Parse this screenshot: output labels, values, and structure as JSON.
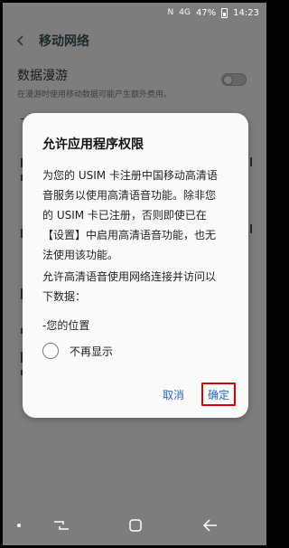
{
  "status_bar": {
    "nfc": "N",
    "signal": "4G",
    "battery_percent": "47%",
    "time": "14:23"
  },
  "header": {
    "title": "移动网络"
  },
  "settings": {
    "roaming_title": "数据漫游",
    "roaming_sub": "在漫游时使用移动数据可能产生额外费用。",
    "roaming_enabled": false
  },
  "dialog": {
    "title": "允许应用程序权限",
    "body_lines": [
      "为您的 USIM 卡注册中国移动高清语",
      "音服务以使用高清语音功能。除非您",
      "的 USIM 卡已注册，否则即使已在",
      "【设置】中启用高清语音功能，也无",
      "法使用该功能。"
    ],
    "body2_lines": [
      "允许高清语音使用网络连接并访问以",
      "下数据："
    ],
    "data_item": "-您的位置",
    "checkbox_label": "不再显示",
    "cancel_label": "取消",
    "confirm_label": "确定"
  },
  "colors": {
    "scrim": "#7d7d7d",
    "button_text": "#2b66b8",
    "highlight": "#d40000"
  }
}
